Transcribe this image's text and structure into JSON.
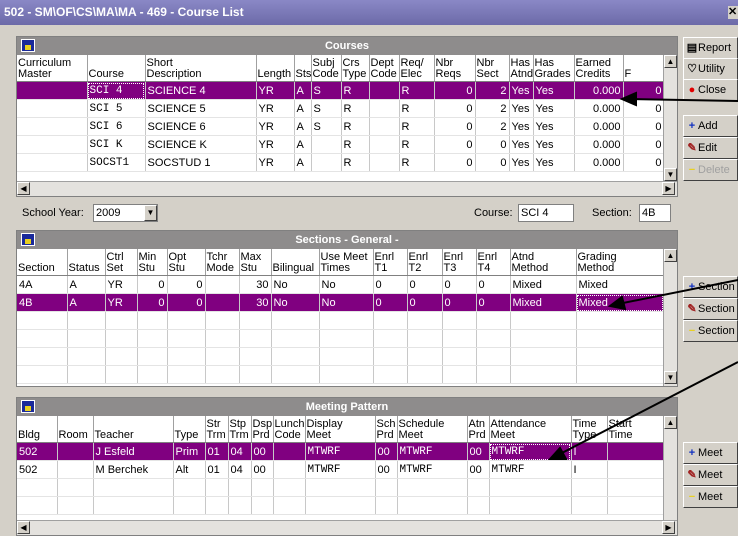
{
  "window": {
    "title": "502 - SM\\OF\\CS\\MA\\MA - 469 - Course List"
  },
  "side_buttons": {
    "report": "Report",
    "utility": "Utility",
    "close": "Close",
    "add": "Add",
    "edit": "Edit",
    "delete": "Delete",
    "section_add": "Section",
    "section_edit": "Section",
    "section_delete": "Section",
    "meet_add": "Meet",
    "meet_edit": "Meet",
    "meet_delete": "Meet"
  },
  "courses": {
    "title": "Courses",
    "columns": [
      "Curriculum\nMaster",
      "Course",
      "Short\nDescription",
      "Length",
      "Sts",
      "Subj\nCode",
      "Crs\nType",
      "Dept\nCode",
      "Req/\nElec",
      "Nbr\nReqs",
      "Nbr\nSect",
      "Has\nAtnd",
      "Has\nGrades",
      "Earned\nCredits",
      "F"
    ],
    "rows": [
      [
        "",
        "SCI 4",
        "SCIENCE 4",
        "YR",
        "A",
        "S",
        "R",
        "",
        "R",
        "0",
        "2",
        "Yes",
        "Yes",
        "0.000",
        "0"
      ],
      [
        "",
        "SCI 5",
        "SCIENCE 5",
        "YR",
        "A",
        "S",
        "R",
        "",
        "R",
        "0",
        "2",
        "Yes",
        "Yes",
        "0.000",
        "0"
      ],
      [
        "",
        "SCI 6",
        "SCIENCE 6",
        "YR",
        "A",
        "S",
        "R",
        "",
        "R",
        "0",
        "2",
        "Yes",
        "Yes",
        "0.000",
        "0"
      ],
      [
        "",
        "SCI K",
        "SCIENCE K",
        "YR",
        "A",
        "",
        "R",
        "",
        "R",
        "0",
        "0",
        "Yes",
        "Yes",
        "0.000",
        "0"
      ],
      [
        "",
        "SOCST1",
        "SOCSTUD 1",
        "YR",
        "A",
        "",
        "R",
        "",
        "R",
        "0",
        "0",
        "Yes",
        "Yes",
        "0.000",
        "0"
      ]
    ]
  },
  "filters": {
    "school_year_label": "School Year:",
    "school_year": "2009",
    "course_label": "Course:",
    "course": "SCI 4",
    "section_label": "Section:",
    "section": "4B"
  },
  "sections": {
    "title": "Sections - General -",
    "columns": [
      "Section",
      "Status",
      "Ctrl\nSet",
      "Min\nStu",
      "Opt\nStu",
      "Tchr\nMode",
      "Max\nStu",
      "Bilingual",
      "Use Meet\nTimes",
      "Enrl\nT1",
      "Enrl\nT2",
      "Enrl\nT3",
      "Enrl\nT4",
      "Atnd\nMethod",
      "Grading\nMethod"
    ],
    "rows": [
      [
        "4A",
        "A",
        "YR",
        "0",
        "0",
        "",
        "30",
        "No",
        "No",
        "0",
        "0",
        "0",
        "0",
        "Mixed",
        "Mixed"
      ],
      [
        "4B",
        "A",
        "YR",
        "0",
        "0",
        "",
        "30",
        "No",
        "No",
        "0",
        "0",
        "0",
        "0",
        "Mixed",
        "Mixed"
      ]
    ]
  },
  "meeting": {
    "title": "Meeting Pattern",
    "columns": [
      "Bldg",
      "Room",
      "Teacher",
      "Type",
      "Str\nTrm",
      "Stp\nTrm",
      "Dsp\nPrd",
      "Lunch\nCode",
      "Display\nMeet",
      "Sch\nPrd",
      "Schedule\nMeet",
      "Atn\nPrd",
      "Attendance\nMeet",
      "Time\nType",
      "Start\nTime"
    ],
    "rows": [
      [
        "502",
        "",
        "J Esfeld",
        "Prim",
        "01",
        "04",
        "00",
        "",
        "MTWRF",
        "00",
        "MTWRF",
        "00",
        "MTWRF",
        "I",
        ""
      ],
      [
        "502",
        "",
        "M Berchek",
        "Alt",
        "01",
        "04",
        "00",
        "",
        "MTWRF",
        "00",
        "MTWRF",
        "00",
        "MTWRF",
        "I",
        ""
      ]
    ]
  }
}
